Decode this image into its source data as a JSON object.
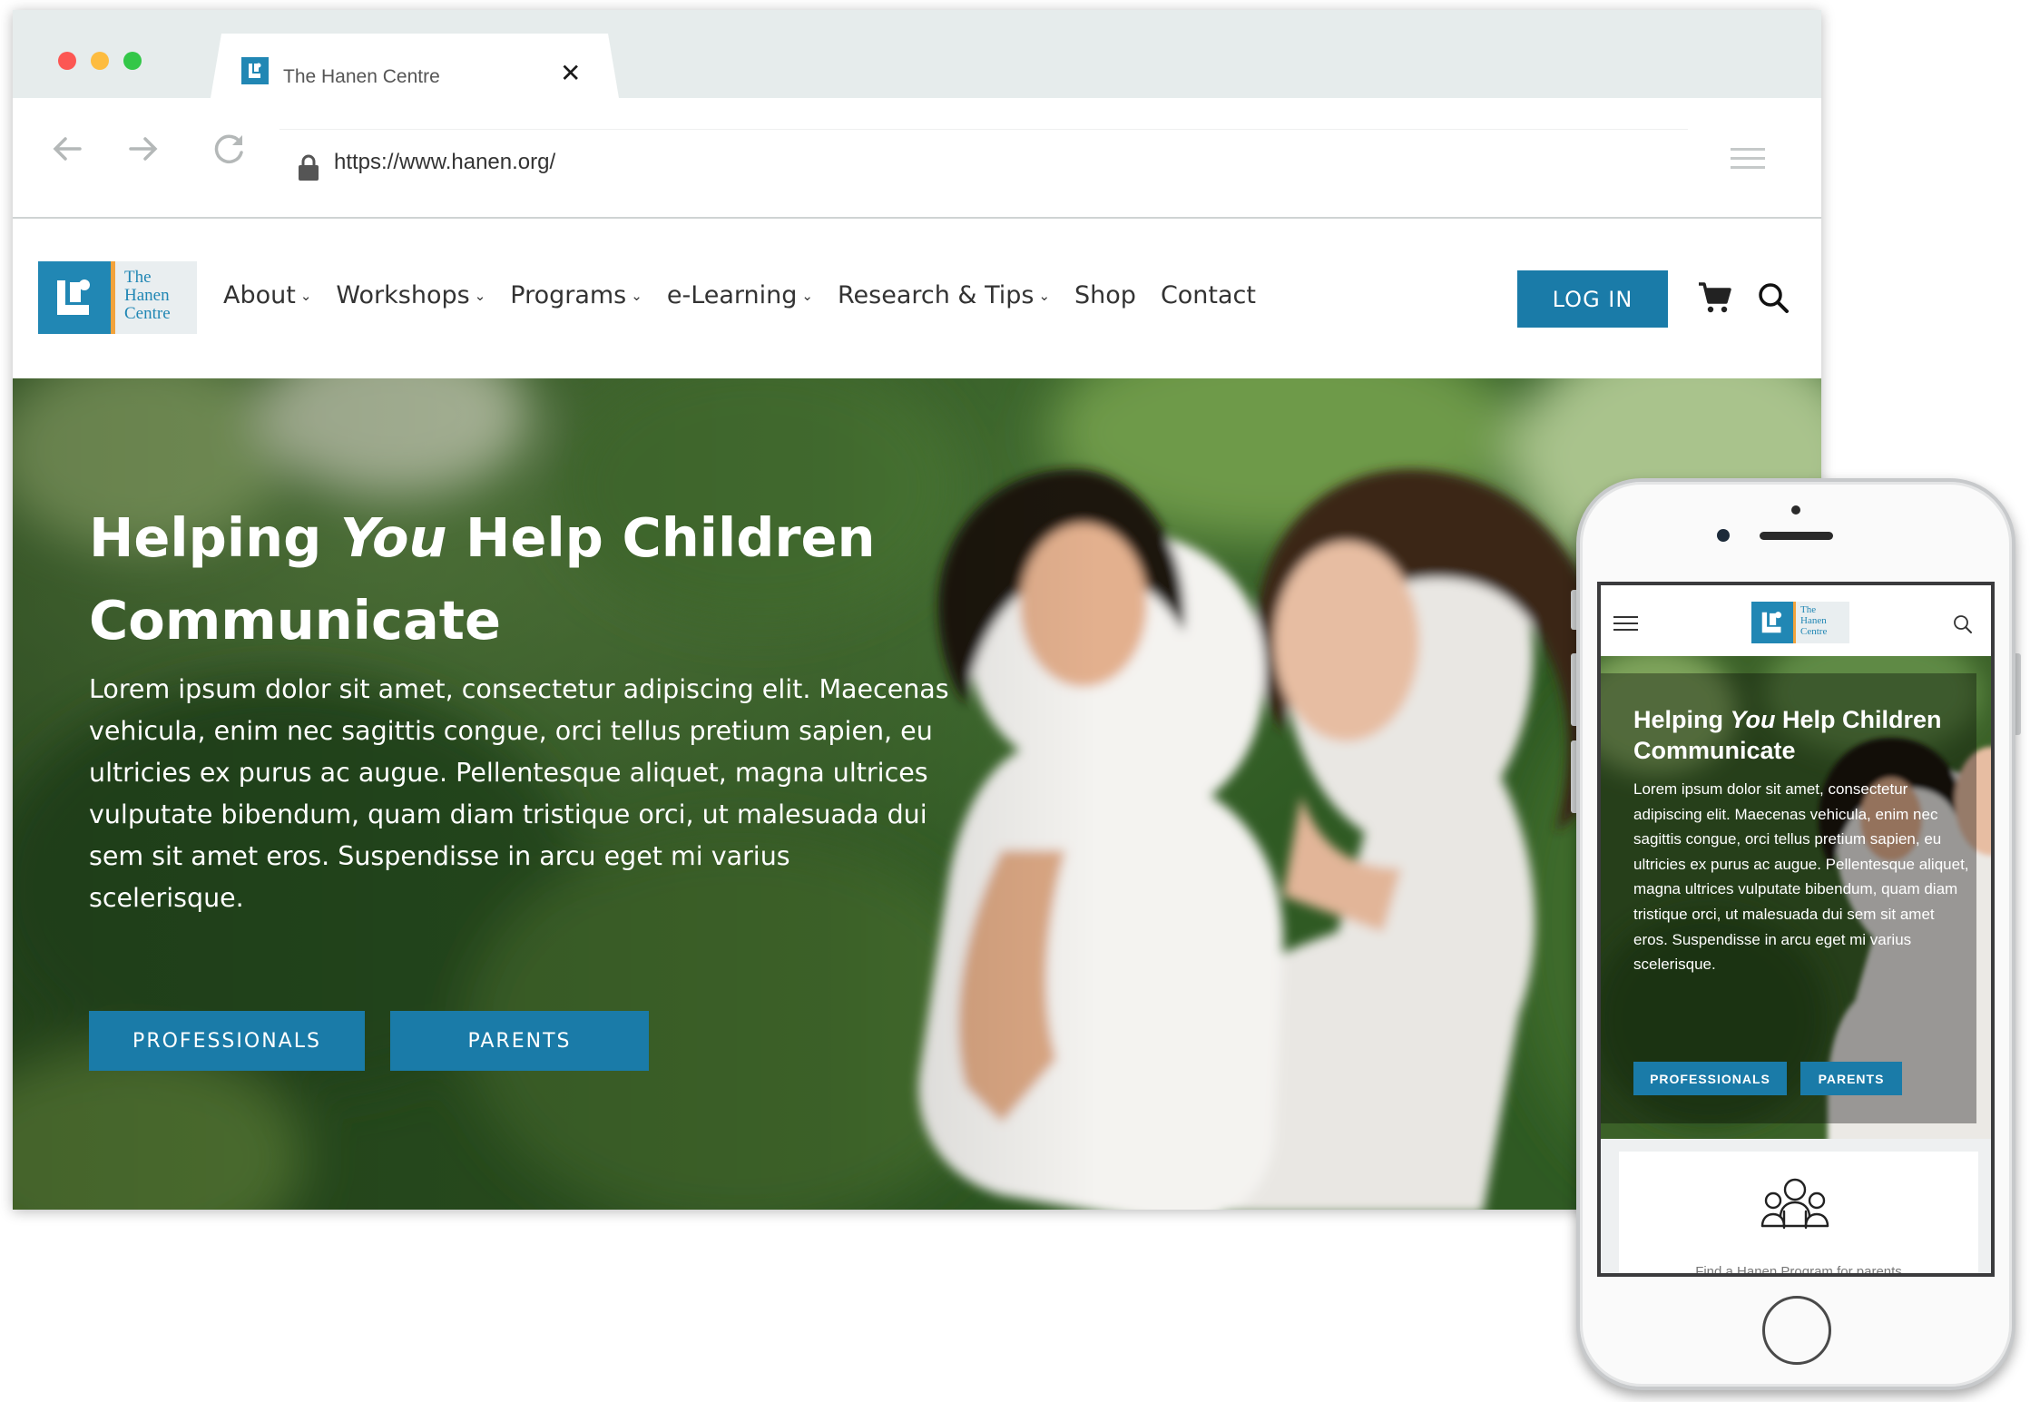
{
  "browser": {
    "tab_title": "The Hanen Centre",
    "tab_close": "✕",
    "url": "https://www.hanen.org/"
  },
  "site": {
    "logo_text": [
      "The",
      "Hanen",
      "Centre"
    ],
    "nav": [
      {
        "label": "About",
        "dropdown": true
      },
      {
        "label": "Workshops",
        "dropdown": true
      },
      {
        "label": "Programs",
        "dropdown": true
      },
      {
        "label": "e-Learning",
        "dropdown": true
      },
      {
        "label": "Research & Tips",
        "dropdown": true
      },
      {
        "label": "Shop",
        "dropdown": false
      },
      {
        "label": "Contact",
        "dropdown": false
      }
    ],
    "login_label": "LOG IN",
    "icons": {
      "cart": "cart-icon",
      "search": "search-icon"
    },
    "colors": {
      "brand_blue": "#1a7ba8",
      "logo_blue": "#2187b4",
      "logo_accent": "#f2a33c"
    }
  },
  "hero": {
    "title_before": "Helping ",
    "title_em": "You",
    "title_after": " Help Children Communicate",
    "body": "Lorem ipsum dolor sit amet, consectetur adipiscing elit. Maecenas vehicula, enim nec sagittis congue, orci tellus pretium sapien, eu ultricies ex purus ac augue. Pellentesque aliquet, magna ultrices vulputate bibendum, quam diam tristique orci, ut malesuada dui sem sit amet eros. Suspendisse in arcu eget mi varius scelerisque.",
    "btn_professionals": "PROFESSIONALS",
    "btn_parents": "PARENTS"
  },
  "mobile": {
    "logo_text": [
      "The",
      "Hanen",
      "Centre"
    ],
    "hero_title_before": "Helping ",
    "hero_title_em": "You",
    "hero_title_after": " Help Children Communicate",
    "hero_body": "Lorem ipsum dolor sit amet, consectetur adipiscing elit. Maecenas vehicula, enim nec sagittis congue, orci tellus pretium sapien, eu ultricies ex purus ac augue. Pellentesque aliquet, magna ultrices vulputate bibendum, quam diam tristique orci, ut malesuada dui sem sit amet eros. Suspendisse in arcu eget mi varius scelerisque.",
    "btn_professionals": "PROFESSIONALS",
    "btn_parents": "PARENTS",
    "card_text": "Find a Hanen Program for parents"
  }
}
